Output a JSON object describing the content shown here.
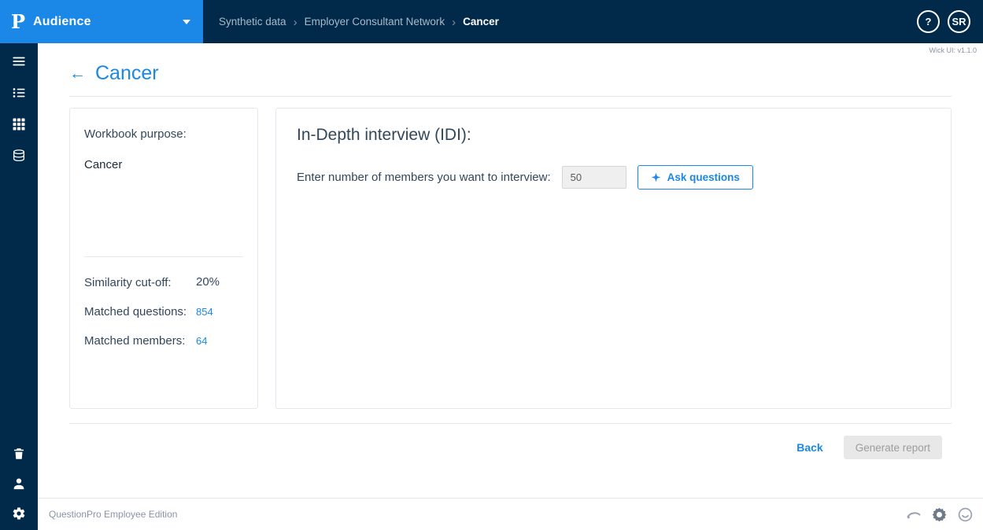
{
  "colors": {
    "accent": "#1b87e6",
    "header_bg": "#012a4a",
    "brand_bg": "#1b87e6"
  },
  "header": {
    "logo_letter": "P",
    "app_name": "Audience",
    "breadcrumb": [
      {
        "label": "Synthetic data"
      },
      {
        "label": "Employer Consultant Network"
      },
      {
        "label": "Cancer"
      }
    ],
    "separator": "›",
    "help_label": "?",
    "avatar_initials": "SR"
  },
  "meta": {
    "version": "Wick UI: v1.1.0"
  },
  "page": {
    "back_arrow": "←",
    "title": "Cancer"
  },
  "summary_card": {
    "purpose_label": "Workbook purpose:",
    "purpose_value": "Cancer",
    "rows": [
      {
        "label": "Similarity cut-off:",
        "value": "20%"
      },
      {
        "label": "Matched questions:",
        "value": "854"
      },
      {
        "label": "Matched members:",
        "value": "64"
      }
    ]
  },
  "idi_card": {
    "title": "In-Depth interview (IDI):",
    "input_label": "Enter number of members you want to interview:",
    "input_value": "50",
    "ask_button_label": "Ask questions"
  },
  "actions": {
    "back_label": "Back",
    "generate_label": "Generate report"
  },
  "footer": {
    "brand_text": "QuestionPro Employee Edition"
  }
}
